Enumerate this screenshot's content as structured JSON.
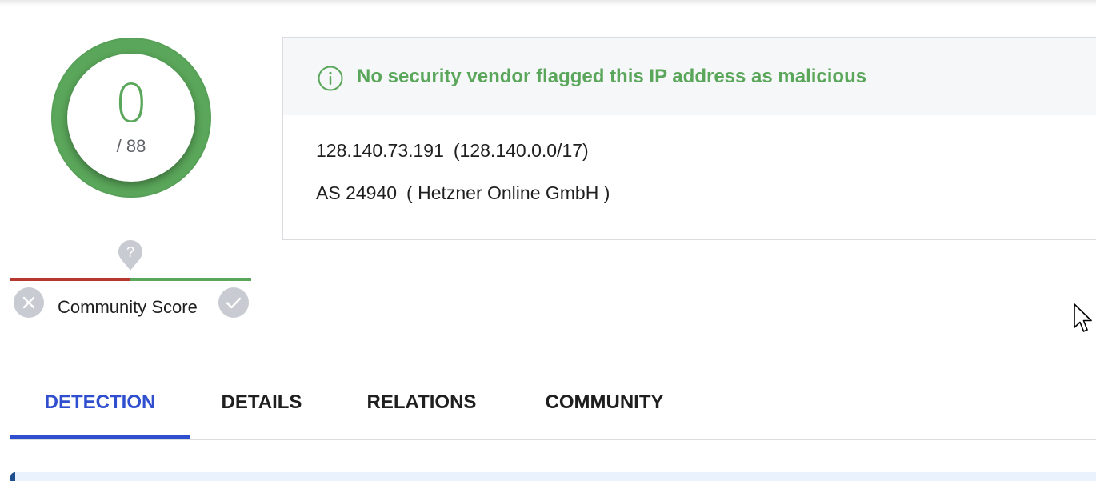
{
  "score": {
    "detections": "0",
    "total": "/ 88",
    "color": "#5aa65a"
  },
  "community": {
    "label": "Community Score",
    "pin_icon": "question-mark-pin-icon",
    "down_icon": "close-icon",
    "up_icon": "check-icon",
    "colors": {
      "negative": "#b7372e",
      "positive": "#5aa65a"
    }
  },
  "summary": {
    "icon": "info-icon",
    "message": "No security vendor flagged this IP address as malicious",
    "ip": "128.140.73.191",
    "network": "(128.140.0.0/17)",
    "asn": "AS 24940",
    "as_owner": "( Hetzner Online GmbH )"
  },
  "tabs": [
    {
      "label": "DETECTION",
      "active": true
    },
    {
      "label": "DETAILS",
      "active": false
    },
    {
      "label": "RELATIONS",
      "active": false
    },
    {
      "label": "COMMUNITY",
      "active": false
    }
  ],
  "colors": {
    "accent": "#2f4fcf",
    "success": "#5aa65a"
  }
}
